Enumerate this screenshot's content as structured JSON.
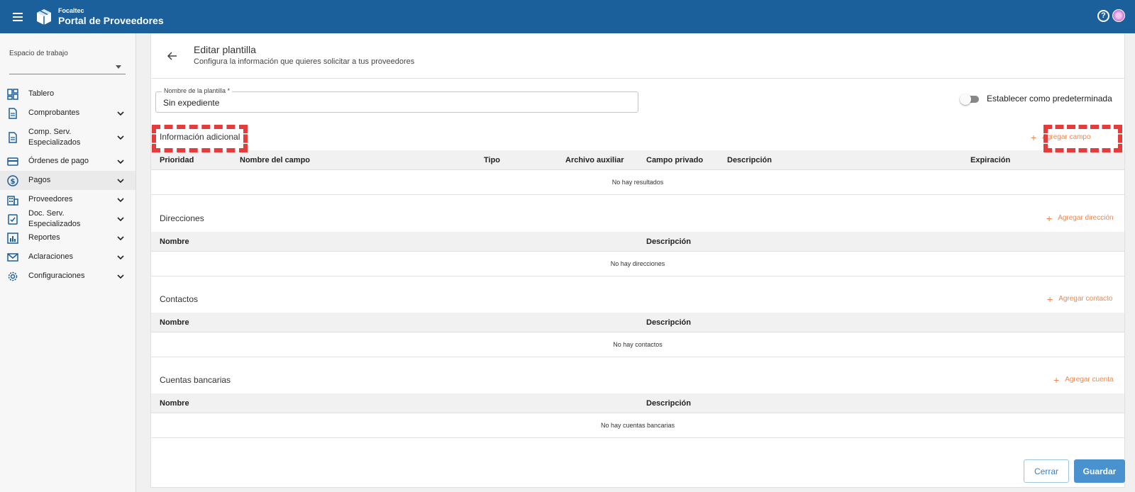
{
  "app": {
    "brand_small": "Focaltec",
    "brand_name": "Portal de Proveedores"
  },
  "sidebar": {
    "workspace_label": "Espacio de trabajo",
    "workspace_value": "",
    "items": [
      {
        "label": "Tablero",
        "icon": "dashboard-icon",
        "expandable": false
      },
      {
        "label": "Comprobantes",
        "icon": "document-icon",
        "expandable": true
      },
      {
        "label": "Comp. Serv. Especializados",
        "icon": "document-icon",
        "expandable": true
      },
      {
        "label": "Órdenes de pago",
        "icon": "card-icon",
        "expandable": true
      },
      {
        "label": "Pagos",
        "icon": "dollar-icon",
        "expandable": true
      },
      {
        "label": "Proveedores",
        "icon": "building-icon",
        "expandable": true
      },
      {
        "label": "Doc. Serv. Especializados",
        "icon": "checklist-icon",
        "expandable": true
      },
      {
        "label": "Reportes",
        "icon": "chart-icon",
        "expandable": true
      },
      {
        "label": "Aclaraciones",
        "icon": "mail-icon",
        "expandable": true
      },
      {
        "label": "Configuraciones",
        "icon": "gear-icon",
        "expandable": true
      }
    ]
  },
  "page": {
    "title": "Editar plantilla",
    "subtitle": "Configura la información que quieres solicitar a tus proveedores",
    "template_name_label": "Nombre de la plantilla *",
    "template_name_value": "Sin expediente",
    "default_toggle_label": "Establecer como predeterminada",
    "default_toggle_on": false
  },
  "sections": {
    "info": {
      "title": "Información adicional",
      "add_label": "Agregar campo",
      "columns": [
        "Prioridad",
        "Nombre del campo",
        "Tipo",
        "Archivo auxiliar",
        "Campo privado",
        "Descripción",
        "Expiración"
      ],
      "empty": "No hay resultados"
    },
    "addresses": {
      "title": "Direcciones",
      "add_label": "Agregar dirección",
      "columns": [
        "Nombre",
        "Descripción"
      ],
      "empty": "No hay direcciones"
    },
    "contacts": {
      "title": "Contactos",
      "add_label": "Agregar contacto",
      "columns": [
        "Nombre",
        "Descripción"
      ],
      "empty": "No hay contactos"
    },
    "accounts": {
      "title": "Cuentas bancarias",
      "add_label": "Agregar cuenta",
      "columns": [
        "Nombre",
        "Descripción"
      ],
      "empty": "No hay cuentas bancarias"
    }
  },
  "actions": {
    "close_label": "Cerrar",
    "save_label": "Guardar"
  },
  "colors": {
    "topbar": "#1b5f9b",
    "accent_orange": "#f2864a",
    "primary_button": "#4a92cf",
    "highlight_red": "#e63b3b"
  }
}
